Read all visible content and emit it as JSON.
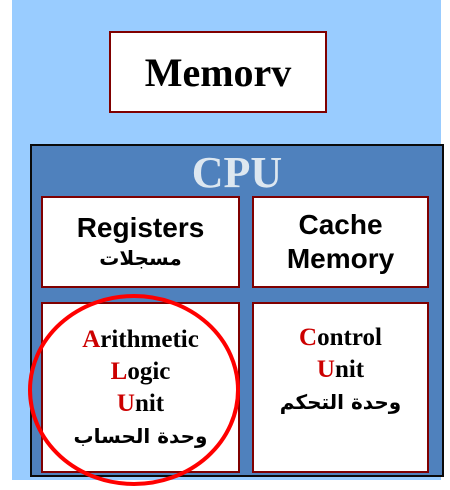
{
  "memory": {
    "label": "Memorv"
  },
  "cpu": {
    "title": "CPU",
    "registers": {
      "label": "Registers",
      "arabic": "مسجلات"
    },
    "cache": {
      "line1": "Cache",
      "line2": "Memory"
    },
    "alu": {
      "line1_initial": "A",
      "line1_rest": "rithmetic",
      "line2_initial": "L",
      "line2_rest": "ogic",
      "line3_initial": "U",
      "line3_rest": "nit",
      "arabic": "وحدة الحساب"
    },
    "control": {
      "line1_initial": "C",
      "line1_rest": "ontrol",
      "line2_initial": "U",
      "line2_rest": "nit",
      "arabic": "وحدة التحكم"
    }
  },
  "colors": {
    "background": "#99ccff",
    "cpu_fill": "#4f81bd",
    "box_border": "#800000",
    "highlight_red": "#cc0000",
    "circle": "#ff0000"
  }
}
